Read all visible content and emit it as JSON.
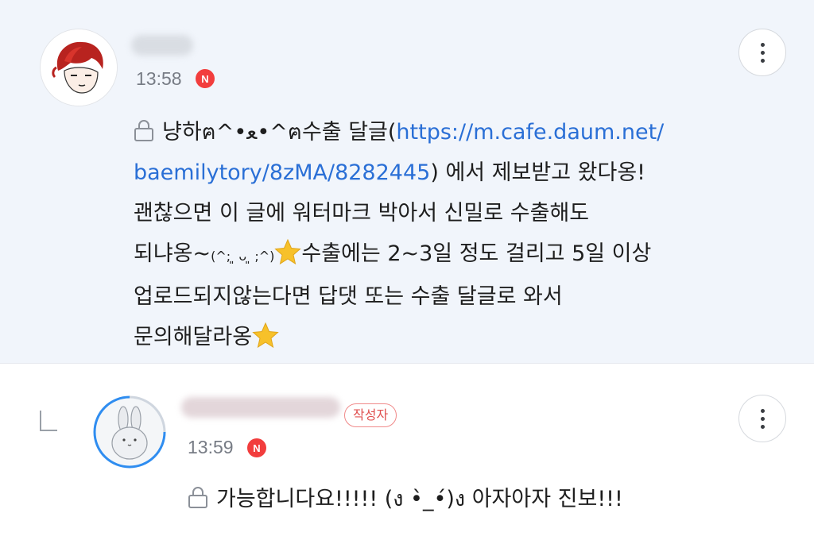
{
  "comments": [
    {
      "time": "13:58",
      "new_badge": "N",
      "body": {
        "line1_pre": "냥하ฅ^•ﻌ•^ฅ수출 달글(",
        "link_part1": "https://m.cafe.daum.net/",
        "link_part2": "baemilytory/8zMA/8282445",
        "line2_post": ") 에서 제보받고 왔다옹!",
        "line3": "괜찮으면 이 글에 워터마크 박아서 신밀로 수출해도",
        "line4_pre": "되냐옹~",
        "emoticon": "(^; ͈ ᴗ ͈ ;^)",
        "line4_post": "수출에는 2~3일 정도 걸리고 5일 이상",
        "line5": "업로드되지않는다면 답댓 또는 수출 달글로 와서",
        "line6": "문의해달라옹"
      },
      "icons": [
        "avatar",
        "lock-icon",
        "star-icon",
        "more-vertical-icon"
      ]
    },
    {
      "time": "13:59",
      "new_badge": "N",
      "author_badge": "작성자",
      "body": "가능합니다요!!!!! (ง •̀_•́)ง 아자아자 진보!!!",
      "icons": [
        "reply-arrow-icon",
        "bunny-avatar",
        "lock-icon",
        "more-vertical-icon"
      ]
    }
  ],
  "colors": {
    "highlight_bg": "#f1f5fb",
    "link": "#2a6fd6",
    "new_badge": "#f23d3d",
    "author_badge": "#e0504f"
  }
}
